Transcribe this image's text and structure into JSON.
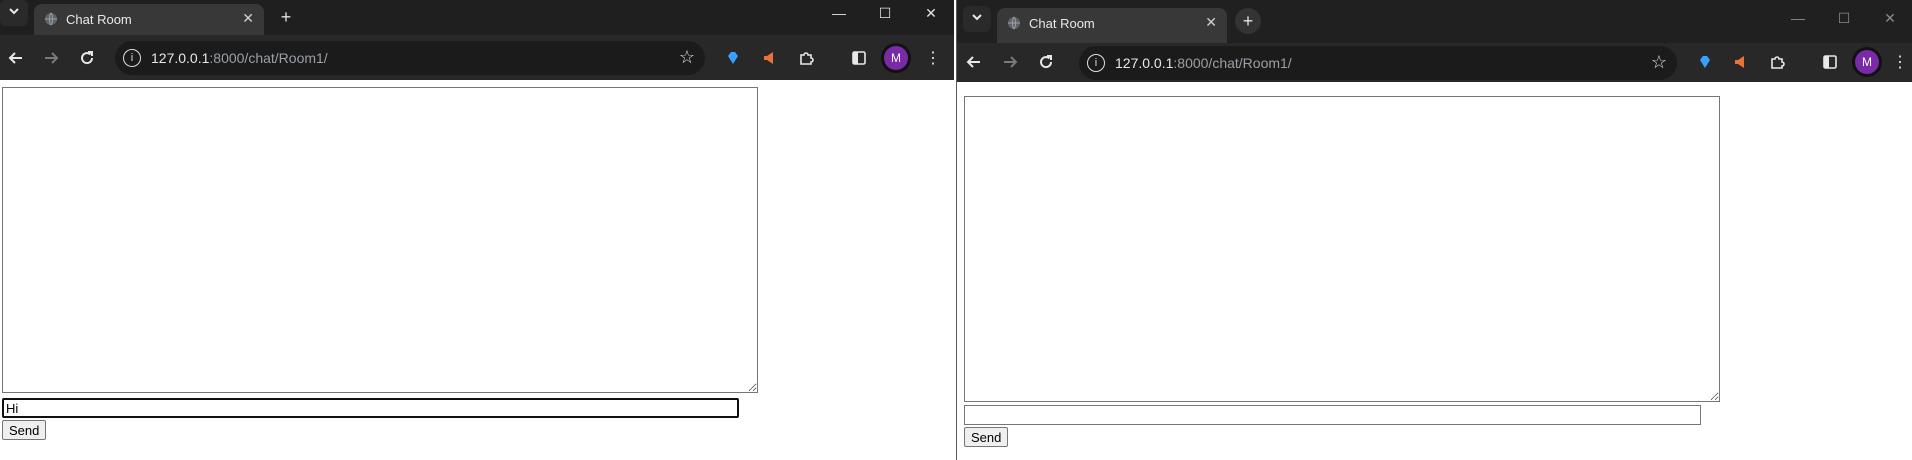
{
  "left_window": {
    "tab": {
      "title": "Chat Room"
    },
    "address_bar": {
      "host": "127.0.0.1",
      "path": ":8000/chat/Room1/"
    },
    "profile": {
      "initial": "M"
    },
    "chat": {
      "log_text": "",
      "message_input_value": "Hi",
      "send_label": "Send"
    }
  },
  "right_window": {
    "tab": {
      "title": "Chat Room"
    },
    "address_bar": {
      "host": "127.0.0.1",
      "path": ":8000/chat/Room1/"
    },
    "profile": {
      "initial": "M"
    },
    "chat": {
      "log_text": "",
      "message_input_value": "",
      "send_label": "Send"
    }
  },
  "icons": {
    "tab_search": "chevron-down-icon",
    "favicon": "globe-icon",
    "close_tab": "close-icon",
    "new_tab": "plus-icon",
    "back": "arrow-left-icon",
    "forward": "arrow-right-icon",
    "reload": "reload-icon",
    "site_info": "info-icon",
    "bookmark": "star-icon",
    "extensions": "puzzle-icon",
    "side_panel": "side-panel-icon",
    "menu": "kebab-menu-icon"
  },
  "colors": {
    "browser_chrome": "#282828",
    "tab_strip": "#1f1f1f",
    "avatar": "#7b2aa7"
  }
}
